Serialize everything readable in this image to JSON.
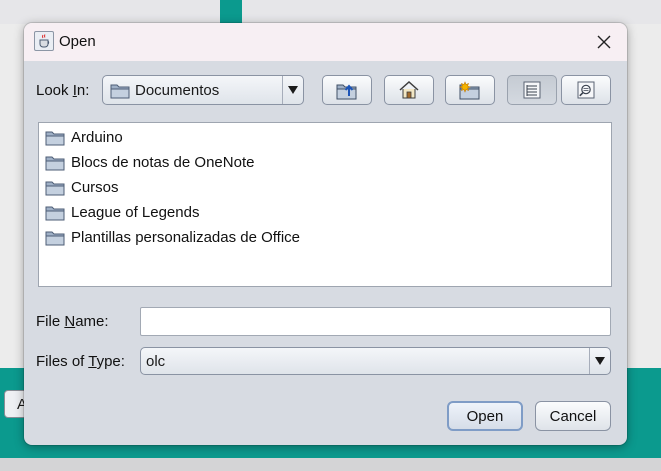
{
  "background": {
    "partial_button_label": "A",
    "accent_color": "#0b9a8e"
  },
  "dialog": {
    "title": "Open",
    "title_icon": "java-cup-icon",
    "close_icon": "close-icon"
  },
  "look_in": {
    "label": "Look ",
    "mnemonic": "I",
    "label_rest": "n:",
    "selected": "Documentos",
    "icon": "folder-icon"
  },
  "toolbar": {
    "buttons": [
      {
        "name": "up-one-level-button",
        "icon": "folder-up-icon"
      },
      {
        "name": "home-button",
        "icon": "home-icon"
      },
      {
        "name": "new-folder-button",
        "icon": "new-folder-icon"
      },
      {
        "name": "list-view-button",
        "icon": "list-view-icon",
        "pressed": true
      },
      {
        "name": "details-view-button",
        "icon": "details-view-icon"
      }
    ]
  },
  "files": [
    {
      "name": "Arduino",
      "type": "folder"
    },
    {
      "name": "Blocs de notas de OneNote",
      "type": "folder"
    },
    {
      "name": "Cursos",
      "type": "folder"
    },
    {
      "name": "League of Legends",
      "type": "folder"
    },
    {
      "name": "Plantillas personalizadas de Office",
      "type": "folder"
    }
  ],
  "file_name": {
    "label_pre": "File ",
    "mnemonic": "N",
    "label_post": "ame:",
    "value": ""
  },
  "files_of_type": {
    "label_pre": "Files of ",
    "mnemonic": "T",
    "label_post": "ype:",
    "selected": "olc"
  },
  "actions": {
    "open": "Open",
    "cancel": "Cancel"
  }
}
